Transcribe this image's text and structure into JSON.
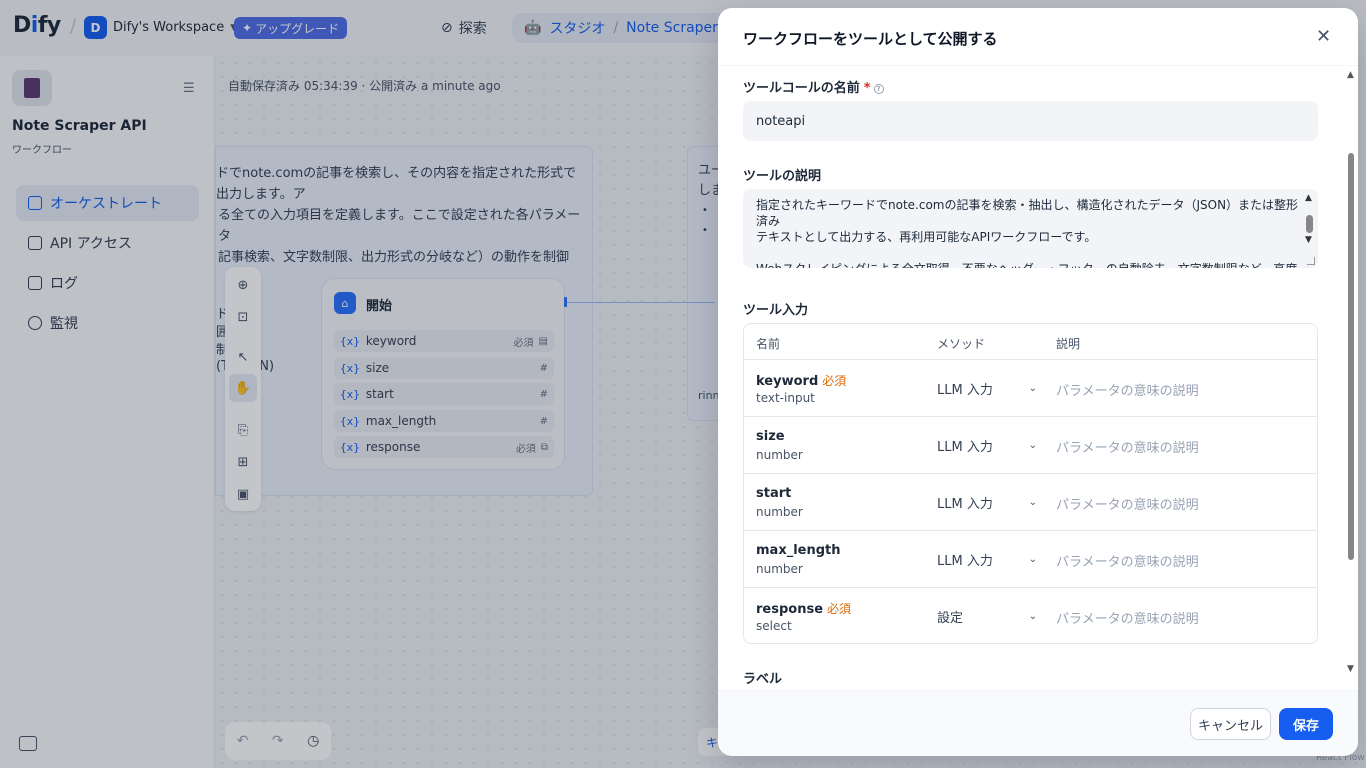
{
  "header": {
    "logo": "Dify",
    "workspace_initial": "D",
    "workspace_name": "Dify's Workspace",
    "upgrade_label": "アップグレード",
    "explore_label": "探索",
    "studio_label": "スタジオ",
    "app_crumb": "Note Scraper AP"
  },
  "sidebar": {
    "app_name": "Note Scraper API",
    "app_type": "ワークフロー",
    "items": [
      {
        "label": "オーケストレート",
        "active": true
      },
      {
        "label": "API アクセス",
        "active": false
      },
      {
        "label": "ログ",
        "active": false
      },
      {
        "label": "監視",
        "active": false
      }
    ]
  },
  "canvas": {
    "autosave": "自動保存済み 05:34:39 · 公開済み a minute ago",
    "note_lines": [
      "ドでnote.comの記事を検索し、その内容を指定された形式で出力します。ア",
      "る全ての入力項目を定義します。ここで設定された各パラメータ",
      "記事検索、文字数制限、出力形式の分岐など）の動作を制御"
    ],
    "frag_lines": [
      "ド",
      "囲",
      "制",
      "(T",
      "ON)"
    ],
    "note2_lines": [
      "ユー",
      "しま",
      "•",
      "•"
    ],
    "note2_bottom": "rinn",
    "start_node": {
      "title": "開始",
      "vars": [
        {
          "name": "keyword",
          "badge": "必須",
          "tag": "▤"
        },
        {
          "name": "size",
          "badge": "",
          "tag": "#"
        },
        {
          "name": "start",
          "badge": "",
          "tag": "#"
        },
        {
          "name": "max_length",
          "badge": "",
          "tag": "#"
        },
        {
          "name": "response",
          "badge": "必須",
          "tag": "⧉"
        }
      ]
    },
    "ki": "キ",
    "react_flow": "React Flow"
  },
  "modal": {
    "title": "ワークフローをツールとして公開する",
    "tool_call_name_label": "ツールコールの名前",
    "tool_call_name_required": "*",
    "tool_call_name_value": "noteapi",
    "description_label": "ツールの説明",
    "description_value": "指定されたキーワードでnote.comの記事を検索・抽出し、構造化されたデータ（JSON）または整形済み\nテキストとして出力する、再利用可能なAPIワークフローです。\n\nWebスクレイピングによる全文取得、不要なヘッダー・フッターの自動除去、文字数制限など、高度なデータ\n整形機能を備えています。",
    "tool_input_label": "ツール入力",
    "columns": {
      "name": "名前",
      "method": "メソッド",
      "description": "説明"
    },
    "params": [
      {
        "name": "keyword",
        "required": "必須",
        "type": "text-input",
        "method": "LLM 入力",
        "placeholder": "パラメータの意味の説明"
      },
      {
        "name": "size",
        "required": "",
        "type": "number",
        "method": "LLM 入力",
        "placeholder": "パラメータの意味の説明"
      },
      {
        "name": "start",
        "required": "",
        "type": "number",
        "method": "LLM 入力",
        "placeholder": "パラメータの意味の説明"
      },
      {
        "name": "max_length",
        "required": "",
        "type": "number",
        "method": "LLM 入力",
        "placeholder": "パラメータの意味の説明"
      },
      {
        "name": "response",
        "required": "必須",
        "type": "select",
        "method": "設定",
        "placeholder": "パラメータの意味の説明"
      }
    ],
    "label_section": "ラベル",
    "cancel_label": "キャンセル",
    "save_label": "保存"
  },
  "colors": {
    "accent": "#155eef",
    "required": "#dc6803"
  }
}
